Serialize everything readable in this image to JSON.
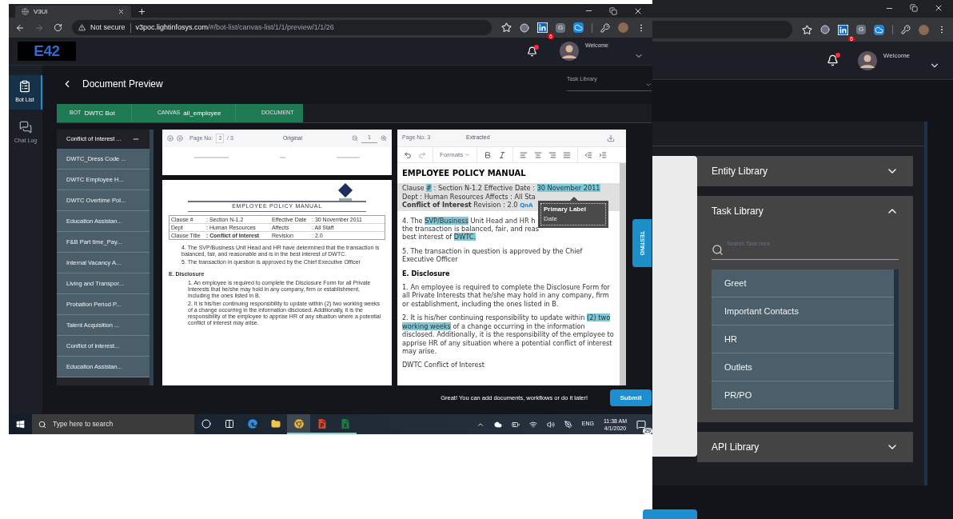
{
  "back_window": {
    "address_bar": {
      "extension_badge": "6",
      "extension_letter": "G"
    },
    "header": {
      "greeting": "Welcome"
    },
    "libraries": [
      {
        "title": "Entity Library",
        "expanded": false
      },
      {
        "title": "Task Library",
        "expanded": true,
        "search_placeholder": "Search Task here",
        "tasks": [
          "Greet",
          "Important Contacts",
          "HR",
          "Outlets",
          "PR/PO"
        ]
      },
      {
        "title": "API Library",
        "expanded": false
      }
    ]
  },
  "front_window": {
    "tab": {
      "title": "V3Ui"
    },
    "address_bar": {
      "security": "Not secure",
      "url_host": "v3poc.lightinfosys.com",
      "url_path": "/#/bot-list/canvas-list/1/1/preview/1/1/26",
      "extension_badge": "6",
      "extension_letter": "G"
    },
    "app_header": {
      "logo": "E42",
      "greeting": "Welcome"
    },
    "rail": [
      {
        "label": "Bot List",
        "kind": "bots",
        "selected": true
      },
      {
        "label": "Chat Log",
        "kind": "chat",
        "selected": false
      }
    ],
    "page_title": "Document Preview",
    "task_library_select": {
      "placeholder": "Task Library"
    },
    "breadcrumb": [
      {
        "caption": "BOT",
        "value": "DWTC Bot"
      },
      {
        "caption": "CANVAS",
        "value": "all_employee"
      },
      {
        "caption": "DOCUMENT"
      }
    ],
    "documents": [
      {
        "title": "Conflict of Interest ...",
        "selected": true
      },
      {
        "title": "DWTC_Dress Code ...",
        "selected": false
      },
      {
        "title": "DWTC Employee H...",
        "selected": false
      },
      {
        "title": "DWTC Overtime Pol...",
        "selected": false
      },
      {
        "title": "Education Assistan...",
        "selected": false
      },
      {
        "title": "F&B Part time_Pay...",
        "selected": false
      },
      {
        "title": "Internal Vacancy A...",
        "selected": false
      },
      {
        "title": "Living and Transpor...",
        "selected": false
      },
      {
        "title": "Probation Period P...",
        "selected": false
      },
      {
        "title": "Talent Acquisition ...",
        "selected": false
      },
      {
        "title": "Conflict of interest...",
        "selected": false
      },
      {
        "title": "Education Assistan...",
        "selected": false
      }
    ],
    "original_panel": {
      "page_label": "Page No:",
      "page": "3",
      "page_total": "/ 3",
      "title": "Original",
      "zoom": "1",
      "document": {
        "title": "EMPLOYEE POLICY MANUAL",
        "table": [
          [
            "Clause #",
            ": Section N-1.2",
            "Effective Date",
            ": 30 November 2011"
          ],
          [
            "Dept",
            ": Human Resources",
            "Affects",
            ": All Staff"
          ],
          [
            "Clause Title",
            ": Conflict of Interest",
            "Revision",
            ": 2.0"
          ]
        ],
        "paragraphs": [
          "4. The SVP/Business Unit Head and HR have determined that the transaction is balanced, fair, and reasonable and is in the best interest of DWTC.",
          "5. The transaction in question is approved by the Chief Executive Officer"
        ],
        "section": "E. Disclosure",
        "section_items": [
          "1. An employee is required to complete the Disclosure Form for all Private Interests that he/she may hold in any company, firm or establishment, including the ones listed in B.",
          "2. It is his/her continuing responsibility to update within (2) two working weeks of a change occurring in the information disclosed. Additionally, it is the responsibility of the employee to apprise HR of any situation where a potential conflict of interest may arise."
        ]
      }
    },
    "extracted_panel": {
      "page_label": "Page No: 3",
      "title": "Extracted",
      "formats": "Formats",
      "heading": "EMPLOYEE POLICY MANUAL",
      "blocks": [
        {
          "kind": "meta",
          "tag": "QnA",
          "lines": [
            [
              {
                "text": "Clause ",
                "highlighted": false
              },
              {
                "text": "#",
                "highlighted": true
              },
              {
                "text": " : Section N-1.2 Effective Date : ",
                "highlighted": false
              },
              {
                "text": "30 November 2011",
                "highlighted": true
              }
            ],
            [
              {
                "text": "Dept : Human Resources Affects : All Sta",
                "highlighted": false
              }
            ],
            [
              {
                "text": "**Conflict of Interest** Revision : 2.0",
                "highlighted": false
              }
            ]
          ]
        },
        {
          "kind": "text",
          "lines": [
            [
              {
                "text": "4. The ",
                "highlighted": false
              },
              {
                "text": "SVP/Business",
                "highlighted": true
              },
              {
                "text": " Unit Head and HR h",
                "highlighted": false
              }
            ],
            [
              {
                "text": "the transaction is balanced, fair, and reas",
                "highlighted": false
              }
            ],
            [
              {
                "text": "best interest of ",
                "highlighted": false
              },
              {
                "text": "DWTC.",
                "highlighted": true
              }
            ]
          ]
        },
        {
          "kind": "text",
          "lines": [
            [
              {
                "text": "5. The transaction in question is approved by the Chief Executive Officer",
                "highlighted": false
              }
            ]
          ]
        },
        {
          "kind": "heading",
          "lines": [
            [
              {
                "text": "E. Disclosure",
                "highlighted": false
              }
            ]
          ]
        },
        {
          "kind": "text",
          "lines": [
            [
              {
                "text": "1. An employee is required to complete the Disclosure Form for all Private Interests that he/she may hold in any company, firm or establishment, including the ones listed in B.",
                "highlighted": false
              }
            ]
          ]
        },
        {
          "kind": "text",
          "lines": [
            [
              {
                "text": "2. It is his/her continuing responsibility to update within ",
                "highlighted": false
              },
              {
                "text": "(2) two working weeks",
                "highlighted": true
              },
              {
                "text": " of a change occurring in the information disclosed. Additionally, it is the responsibility of the employee to apprise HR of any situation where a potential conflict of interest may arise.",
                "highlighted": false
              }
            ]
          ]
        },
        {
          "kind": "text",
          "lines": [
            [
              {
                "text": "DWTC Conflict of Interest",
                "highlighted": false
              }
            ]
          ]
        }
      ],
      "tooltip": {
        "title": "Primary Label",
        "value": "Date"
      }
    },
    "testing_tab": "TESTING",
    "footer": {
      "message": "Great! You can add documents, workflows or do it later!",
      "submit": "Submit"
    }
  },
  "taskbar": {
    "search_placeholder": "Type here to search",
    "apps": [
      {
        "kind": "cortana",
        "selected": false,
        "running": false
      },
      {
        "kind": "taskview",
        "selected": false,
        "running": false
      },
      {
        "kind": "edge",
        "selected": false,
        "running": false
      },
      {
        "kind": "explorer",
        "selected": false,
        "running": false
      },
      {
        "kind": "chrome",
        "selected": true,
        "running": true
      },
      {
        "kind": "powerpoint",
        "selected": false,
        "running": true
      },
      {
        "kind": "excel",
        "selected": false,
        "running": true
      }
    ],
    "language": "ENG",
    "time": "11:38 AM",
    "date": "4/1/2020",
    "notifications": "29"
  }
}
